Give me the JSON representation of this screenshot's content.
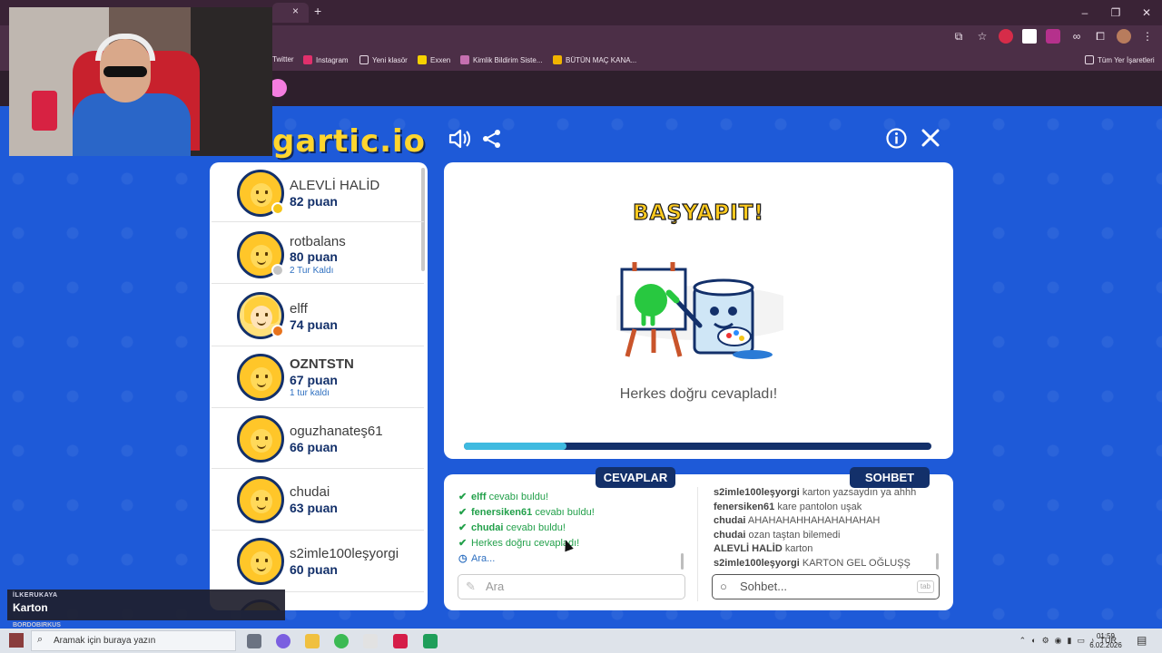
{
  "browser": {
    "bookmarks": [
      "Twitter",
      "Instagram",
      "Yeni klasör",
      "Exxen",
      "Kimlik Bildirim Siste...",
      "BÜTÜN MAÇ KANA..."
    ],
    "all_bookmarks": "Tüm Yer İşaretleri",
    "new_tab": "+",
    "tab_close": "×",
    "window_controls": [
      "–",
      "❐",
      "✕"
    ]
  },
  "game": {
    "logo": "gartic.io",
    "players": [
      {
        "name": "ALEVLİ HALİD",
        "score": "82 puan",
        "status": "",
        "badge_color": "#f5c518"
      },
      {
        "name": "rotbalans",
        "score": "80 puan",
        "status": "2 Tur Kaldı",
        "badge_color": "#c4c4c4"
      },
      {
        "name": "elff",
        "score": "74 puan",
        "status": "",
        "badge_color": "#e8731c"
      },
      {
        "name": "OZNTSTN",
        "score": "67 puan",
        "status": "1 tur kaldı",
        "badge_color": ""
      },
      {
        "name": "oguzhanateş61",
        "score": "66 puan",
        "status": "",
        "badge_color": ""
      },
      {
        "name": "chudai",
        "score": "63 puan",
        "status": "",
        "badge_color": ""
      },
      {
        "name": "s2imle100leşyorgi",
        "score": "60 puan",
        "status": "",
        "badge_color": ""
      }
    ],
    "board": {
      "title": "BAŞYAPIT!",
      "message": "Herkes doğru cevapladı!",
      "progress": 0.22
    },
    "answers_tab": "CEVAPLAR",
    "chat_tab": "SOHBET",
    "answers": [
      {
        "user": "elff",
        "text": "cevabı buldu!"
      },
      {
        "user": "fenersiken61",
        "text": "cevabı buldu!"
      },
      {
        "user": "chudai",
        "text": "cevabı buldu!"
      },
      {
        "user": "",
        "text": "Herkes doğru cevapladı!"
      }
    ],
    "answers_wait": "Ara...",
    "answer_placeholder": "Ara",
    "chat": [
      {
        "user": "s2imle100leşyorgi",
        "text": "karton yazsaydın ya ahhh"
      },
      {
        "user": "fenersiken61",
        "text": "kare pantolon uşak"
      },
      {
        "user": "chudai",
        "text": "AHAHAHAHHAHAHAHAHAH"
      },
      {
        "user": "chudai",
        "text": "ozan taştan bilemedi"
      },
      {
        "user": "ALEVLİ HALİD",
        "text": "karton"
      },
      {
        "user": "s2imle100leşyorgi",
        "text": "KARTON GEL OĞLUŞŞ"
      }
    ],
    "chat_placeholder": "Sohbet...",
    "tab_key": "tab"
  },
  "overlay": {
    "label": "İLKERUKAYA",
    "value": "Karton",
    "sub": "BORDOBIRKUS"
  },
  "taskbar": {
    "search_placeholder": "Aramak için buraya yazın",
    "lang": "TUR",
    "time": "01:59",
    "date": "6.02.2026"
  }
}
